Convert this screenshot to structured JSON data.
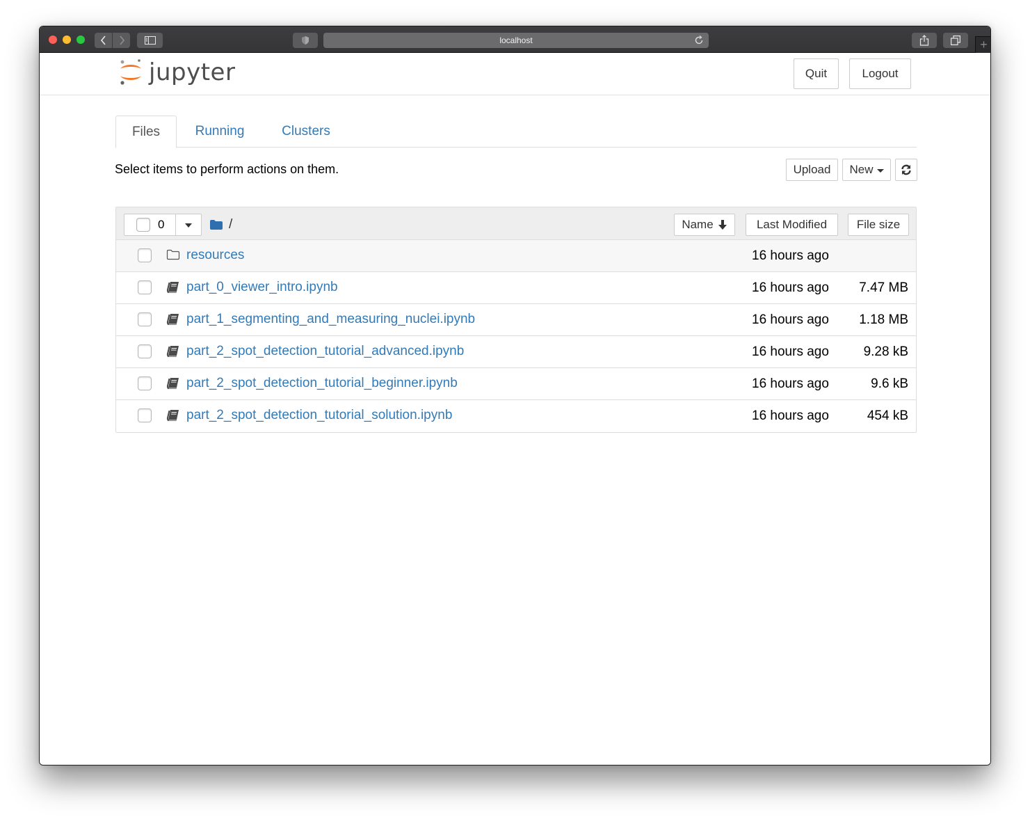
{
  "browser": {
    "address": "localhost",
    "new_tab_symbol": "+"
  },
  "header": {
    "logo_text": "jupyter",
    "quit_label": "Quit",
    "logout_label": "Logout"
  },
  "tabs": [
    {
      "label": "Files",
      "active": true
    },
    {
      "label": "Running",
      "active": false
    },
    {
      "label": "Clusters",
      "active": false
    }
  ],
  "toolbar": {
    "instructions": "Select items to perform actions on them.",
    "upload_label": "Upload",
    "new_label": "New"
  },
  "list_header": {
    "selected_count": "0",
    "path": "/",
    "sort_name_label": "Name",
    "sort_modified_label": "Last Modified",
    "sort_size_label": "File size"
  },
  "items": [
    {
      "type": "folder",
      "icon": "folder-icon",
      "name": "resources",
      "modified": "16 hours ago",
      "size": ""
    },
    {
      "type": "notebook",
      "icon": "notebook-icon",
      "name": "part_0_viewer_intro.ipynb",
      "modified": "16 hours ago",
      "size": "7.47 MB"
    },
    {
      "type": "notebook",
      "icon": "notebook-icon",
      "name": "part_1_segmenting_and_measuring_nuclei.ipynb",
      "modified": "16 hours ago",
      "size": "1.18 MB"
    },
    {
      "type": "notebook",
      "icon": "notebook-icon",
      "name": "part_2_spot_detection_tutorial_advanced.ipynb",
      "modified": "16 hours ago",
      "size": "9.28 kB"
    },
    {
      "type": "notebook",
      "icon": "notebook-icon",
      "name": "part_2_spot_detection_tutorial_beginner.ipynb",
      "modified": "16 hours ago",
      "size": "9.6 kB"
    },
    {
      "type": "notebook",
      "icon": "notebook-icon",
      "name": "part_2_spot_detection_tutorial_solution.ipynb",
      "modified": "16 hours ago",
      "size": "454 kB"
    }
  ],
  "colors": {
    "link": "#337ab7",
    "jupyter_orange": "#f37726",
    "traffic_red": "#fe5f57",
    "traffic_yellow": "#febc2e",
    "traffic_green": "#28c840"
  }
}
